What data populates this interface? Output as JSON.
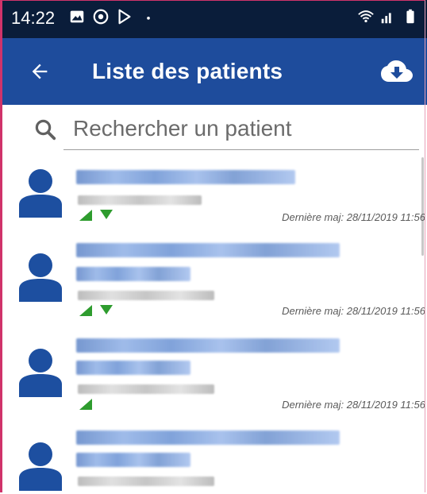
{
  "status_bar": {
    "time": "14:22",
    "icons_left": [
      "image-icon",
      "sync-circle-icon",
      "play-store-icon",
      "dot-icon"
    ],
    "icons_right": [
      "wifi-icon",
      "signal-icon",
      "battery-icon"
    ]
  },
  "app_bar": {
    "title": "Liste des patients",
    "back_icon": "arrow-left-icon",
    "action_icon": "cloud-download-icon"
  },
  "search": {
    "placeholder": "Rechercher un patient",
    "value": ""
  },
  "patients": [
    {
      "updated": "Dernière maj: 28/11/2019 11:56",
      "sync": [
        "up",
        "down"
      ]
    },
    {
      "updated": "Dernière maj: 28/11/2019 11:56",
      "sync": [
        "up",
        "down"
      ]
    },
    {
      "updated": "Dernière maj: 28/11/2019 11:56",
      "sync": [
        "up"
      ]
    },
    {
      "updated": "",
      "sync": []
    }
  ],
  "colors": {
    "status_bar": "#0a1d3a",
    "app_bar": "#1e4c9c",
    "avatar": "#1d4fa0",
    "sync_green": "#2e9c2e"
  }
}
